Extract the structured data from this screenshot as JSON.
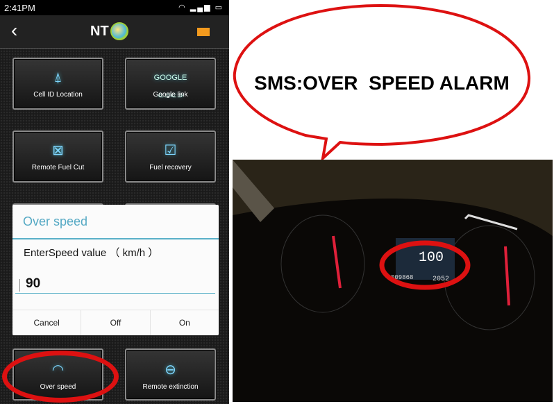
{
  "status_bar": {
    "time": "2:41PM",
    "icons": [
      "wifi-icon",
      "signal-icon",
      "battery-icon"
    ]
  },
  "header": {
    "logo_text": "NT",
    "back_icon": "chevron-left-icon",
    "mail_icon": "mail-icon"
  },
  "tiles": [
    {
      "label": "Cell ID Location",
      "icon": "cell-tower-icon"
    },
    {
      "label": "Google link",
      "icon": "google-link-icon",
      "icon_text": "GOOGLE"
    },
    {
      "label": "Remote Fuel Cut",
      "icon": "engine-x-icon"
    },
    {
      "label": "Fuel recovery",
      "icon": "engine-check-icon"
    },
    {
      "label": "Over speed",
      "icon": "speedometer-icon"
    },
    {
      "label": "Remote extinction",
      "icon": "power-icon"
    }
  ],
  "dialog": {
    "title": "Over speed",
    "label": "EnterSpeed value （ km/h ）",
    "value": "90",
    "buttons": [
      "Cancel",
      "Off",
      "On"
    ]
  },
  "bubble": {
    "text": "SMS:OVER  SPEED ALARM"
  },
  "dashboard": {
    "speed": "100",
    "odometer": "009868",
    "right_value": "2052"
  },
  "colors": {
    "accent": "#55a9c4",
    "highlight": "#d11111",
    "mail": "#f39a1e"
  }
}
